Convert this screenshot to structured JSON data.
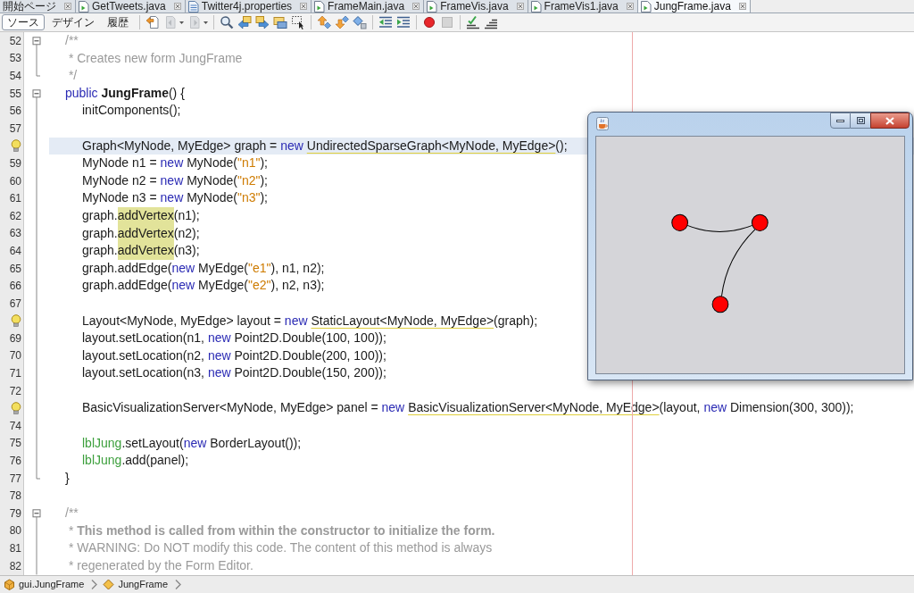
{
  "editor_tabs": [
    {
      "label": "開始ページ",
      "kind": "start",
      "selected": false
    },
    {
      "label": "GetTweets.java",
      "kind": "java",
      "selected": false
    },
    {
      "label": "Twitter4j.properties",
      "kind": "properties",
      "selected": false
    },
    {
      "label": "FrameMain.java",
      "kind": "java",
      "selected": false
    },
    {
      "label": "FrameVis.java",
      "kind": "java",
      "selected": false
    },
    {
      "label": "FrameVis1.java",
      "kind": "java",
      "selected": false
    },
    {
      "label": "JungFrame.java",
      "kind": "java",
      "selected": true
    }
  ],
  "toolbar": {
    "views": [
      {
        "label": "ソース",
        "selected": true
      },
      {
        "label": "デザイン",
        "selected": false
      },
      {
        "label": "履歴",
        "selected": false
      }
    ],
    "groups": [
      {
        "buttons": [
          {
            "kind": "last_edit",
            "disabled": false,
            "dropdown": false
          },
          {
            "kind": "back",
            "disabled": true,
            "dropdown": true
          },
          {
            "kind": "forward",
            "disabled": true,
            "dropdown": true
          }
        ]
      },
      {
        "buttons": [
          {
            "kind": "find",
            "disabled": false,
            "dropdown": false
          },
          {
            "kind": "find_previous",
            "disabled": false,
            "dropdown": false
          },
          {
            "kind": "find_next",
            "disabled": false,
            "dropdown": false
          },
          {
            "kind": "toggle_highlight",
            "disabled": false,
            "dropdown": false
          },
          {
            "kind": "rectangular_selection",
            "disabled": false,
            "dropdown": false
          }
        ]
      },
      {
        "buttons": [
          {
            "kind": "previous_bookmark",
            "disabled": false,
            "dropdown": false
          },
          {
            "kind": "next_bookmark",
            "disabled": false,
            "dropdown": false
          },
          {
            "kind": "toggle_bookmark",
            "disabled": false,
            "dropdown": false
          }
        ]
      },
      {
        "buttons": [
          {
            "kind": "shift_left",
            "disabled": false,
            "dropdown": false
          },
          {
            "kind": "shift_right",
            "disabled": false,
            "dropdown": false
          }
        ]
      },
      {
        "buttons": [
          {
            "kind": "start_macro",
            "disabled": false,
            "dropdown": false
          },
          {
            "kind": "stop_macro",
            "disabled": true,
            "dropdown": false
          }
        ]
      },
      {
        "buttons": [
          {
            "kind": "comment",
            "disabled": false,
            "dropdown": false
          },
          {
            "kind": "uncomment",
            "disabled": false,
            "dropdown": false
          }
        ]
      }
    ]
  },
  "editor": {
    "lines": [
      {
        "number": "52",
        "hint": false,
        "current": false,
        "kind": "fold_start",
        "tokens": [
          {
            "text": "/**",
            "kind": "comment"
          }
        ]
      },
      {
        "number": "53",
        "hint": false,
        "current": false,
        "kind": "fold_body",
        "tokens": [
          {
            "text": " * Creates new form JungFrame",
            "kind": "comment"
          }
        ]
      },
      {
        "number": "54",
        "hint": false,
        "current": false,
        "kind": "fold_end",
        "tokens": [
          {
            "text": " */",
            "kind": "comment"
          }
        ]
      },
      {
        "number": "55",
        "hint": false,
        "current": false,
        "kind": "fold_start",
        "tokens": [
          {
            "text": "public ",
            "kind": "keyword"
          },
          {
            "text": "JungFrame",
            "kind": "bold"
          },
          {
            "text": "() {",
            "kind": "plain"
          }
        ],
        "children": [
          {
            "number": "56",
            "hint": false,
            "current": false,
            "kind": "fold_body",
            "tokens": [
              {
                "text": "initComponents();",
                "kind": "plain"
              }
            ]
          },
          {
            "number": "57",
            "hint": false,
            "current": false,
            "kind": "fold_body"
          },
          {
            "hint": true,
            "current": true,
            "kind": "fold_body",
            "tokens": [
              {
                "text": "Graph<MyNode, MyEdge> graph = ",
                "kind": "plain"
              },
              {
                "text": "new ",
                "kind": "keyword"
              },
              {
                "text": "UndirectedSparseGraph<MyNode, MyEdge>",
                "kind": "hint"
              },
              {
                "text": "();",
                "kind": "plain"
              }
            ]
          },
          {
            "number": "59",
            "hint": false,
            "current": false,
            "kind": "fold_body",
            "tokens": [
              {
                "text": "MyNode n1 = ",
                "kind": "plain"
              },
              {
                "text": "new ",
                "kind": "keyword"
              },
              {
                "text": "MyNode(",
                "kind": "plain"
              },
              {
                "text": "\"n1\"",
                "kind": "string"
              },
              {
                "text": ");",
                "kind": "plain"
              }
            ]
          },
          {
            "number": "60",
            "hint": false,
            "current": false,
            "kind": "fold_body",
            "tokens": [
              {
                "text": "MyNode n2 = ",
                "kind": "plain"
              },
              {
                "text": "new ",
                "kind": "keyword"
              },
              {
                "text": "MyNode(",
                "kind": "plain"
              },
              {
                "text": "\"n2\"",
                "kind": "string"
              },
              {
                "text": ");",
                "kind": "plain"
              }
            ]
          },
          {
            "number": "61",
            "hint": false,
            "current": false,
            "kind": "fold_body",
            "tokens": [
              {
                "text": "MyNode n3 = ",
                "kind": "plain"
              },
              {
                "text": "new ",
                "kind": "keyword"
              },
              {
                "text": "MyNode(",
                "kind": "plain"
              },
              {
                "text": "\"n3\"",
                "kind": "string"
              },
              {
                "text": ");",
                "kind": "plain"
              }
            ]
          },
          {
            "number": "62",
            "hint": false,
            "current": false,
            "kind": "fold_body",
            "tokens": [
              {
                "text": "graph.",
                "kind": "plain"
              },
              {
                "text": "addVertex",
                "kind": "occurrence"
              },
              {
                "text": "(n1);",
                "kind": "plain"
              }
            ]
          },
          {
            "number": "63",
            "hint": false,
            "current": false,
            "kind": "fold_body",
            "tokens": [
              {
                "text": "graph.",
                "kind": "plain"
              },
              {
                "text": "addVertex",
                "kind": "occurrence"
              },
              {
                "text": "(n2);",
                "kind": "plain"
              }
            ]
          },
          {
            "number": "64",
            "hint": false,
            "current": false,
            "kind": "fold_body",
            "tokens": [
              {
                "text": "graph.",
                "kind": "plain"
              },
              {
                "text": "addVertex",
                "kind": "occurrence"
              },
              {
                "text": "(n3);",
                "kind": "plain"
              }
            ]
          },
          {
            "number": "65",
            "hint": false,
            "current": false,
            "kind": "fold_body",
            "tokens": [
              {
                "text": "graph.addEdge(",
                "kind": "plain"
              },
              {
                "text": "new ",
                "kind": "keyword"
              },
              {
                "text": "MyEdge(",
                "kind": "plain"
              },
              {
                "text": "\"e1\"",
                "kind": "string"
              },
              {
                "text": "), n1, n2);",
                "kind": "plain"
              }
            ]
          },
          {
            "number": "66",
            "hint": false,
            "current": false,
            "kind": "fold_body",
            "tokens": [
              {
                "text": "graph.addEdge(",
                "kind": "plain"
              },
              {
                "text": "new ",
                "kind": "keyword"
              },
              {
                "text": "MyEdge(",
                "kind": "plain"
              },
              {
                "text": "\"e2\"",
                "kind": "string"
              },
              {
                "text": "), n2, n3);",
                "kind": "plain"
              }
            ]
          },
          {
            "number": "67",
            "hint": false,
            "current": false,
            "kind": "fold_body"
          },
          {
            "hint": true,
            "current": false,
            "kind": "fold_body",
            "tokens": [
              {
                "text": "Layout<MyNode, MyEdge> layout = ",
                "kind": "plain"
              },
              {
                "text": "new ",
                "kind": "keyword"
              },
              {
                "text": "StaticLayout<MyNode, MyEdge>",
                "kind": "hint"
              },
              {
                "text": "(graph);",
                "kind": "plain"
              }
            ]
          },
          {
            "number": "69",
            "hint": false,
            "current": false,
            "kind": "fold_body",
            "tokens": [
              {
                "text": "layout.setLocation(n1, ",
                "kind": "plain"
              },
              {
                "text": "new ",
                "kind": "keyword"
              },
              {
                "text": "Point2D.Double(100, 100));",
                "kind": "plain"
              }
            ]
          },
          {
            "number": "70",
            "hint": false,
            "current": false,
            "kind": "fold_body",
            "tokens": [
              {
                "text": "layout.setLocation(n2, ",
                "kind": "plain"
              },
              {
                "text": "new ",
                "kind": "keyword"
              },
              {
                "text": "Point2D.Double(200, 100));",
                "kind": "plain"
              }
            ]
          },
          {
            "number": "71",
            "hint": false,
            "current": false,
            "kind": "fold_body",
            "tokens": [
              {
                "text": "layout.setLocation(n3, ",
                "kind": "plain"
              },
              {
                "text": "new ",
                "kind": "keyword"
              },
              {
                "text": "Point2D.Double(150, 200));",
                "kind": "plain"
              }
            ]
          },
          {
            "number": "72",
            "hint": false,
            "current": false,
            "kind": "fold_body"
          },
          {
            "hint": true,
            "current": false,
            "kind": "fold_body",
            "tokens": [
              {
                "text": "BasicVisualizationServer<MyNode, MyEdge> panel = ",
                "kind": "plain"
              },
              {
                "text": "new ",
                "kind": "keyword"
              },
              {
                "text": "BasicVisualizationServer<MyNode, MyEdge>",
                "kind": "hint"
              },
              {
                "text": "(layout, ",
                "kind": "plain"
              },
              {
                "text": "new ",
                "kind": "keyword"
              },
              {
                "text": "Dimension(300, 300));",
                "kind": "plain"
              }
            ]
          },
          {
            "number": "74",
            "hint": false,
            "current": false,
            "kind": "fold_body"
          },
          {
            "number": "75",
            "hint": false,
            "current": false,
            "kind": "fold_body",
            "tokens": [
              {
                "text": "lblJung",
                "kind": "field"
              },
              {
                "text": ".setLayout(",
                "kind": "plain"
              },
              {
                "text": "new ",
                "kind": "keyword"
              },
              {
                "text": "BorderLayout());",
                "kind": "plain"
              }
            ]
          },
          {
            "number": "76",
            "hint": false,
            "current": false,
            "kind": "fold_body",
            "tokens": [
              {
                "text": "lblJung",
                "kind": "field"
              },
              {
                "text": ".add(panel);",
                "kind": "plain"
              }
            ]
          }
        ]
      },
      {
        "number": "77",
        "hint": false,
        "current": false,
        "kind": "fold_end",
        "tokens": [
          {
            "text": "}",
            "kind": "plain"
          }
        ]
      },
      {
        "number": "78",
        "hint": false,
        "current": false,
        "kind": "plain"
      },
      {
        "number": "79",
        "hint": false,
        "current": false,
        "kind": "fold_start",
        "tokens": [
          {
            "text": "/**",
            "kind": "comment"
          }
        ]
      },
      {
        "number": "80",
        "hint": false,
        "current": false,
        "kind": "fold_body",
        "tokens": [
          {
            "text": " * ",
            "kind": "comment"
          },
          {
            "text": "This method is called from within the constructor to initialize the form.",
            "kind": "comment_bold"
          }
        ]
      },
      {
        "number": "81",
        "hint": false,
        "current": false,
        "kind": "fold_body",
        "tokens": [
          {
            "text": " * WARNING: Do NOT modify this code. The content of this method is always",
            "kind": "comment"
          }
        ]
      },
      {
        "number": "82",
        "hint": false,
        "current": false,
        "kind": "fold_body",
        "tokens": [
          {
            "text": " * regenerated by the Form Editor.",
            "kind": "comment"
          }
        ]
      }
    ]
  },
  "breadcrumbs": [
    {
      "label": "gui.JungFrame",
      "kind": "package"
    },
    {
      "label": "JungFrame",
      "kind": "class"
    }
  ]
}
